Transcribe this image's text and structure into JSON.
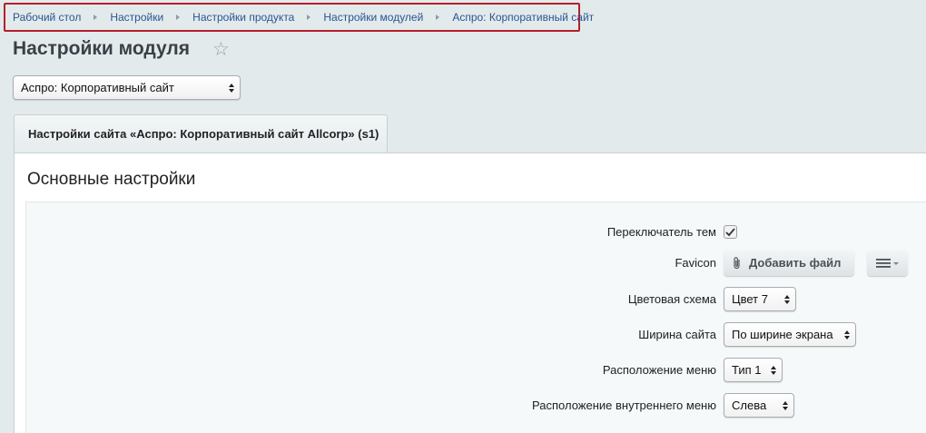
{
  "breadcrumb": {
    "items": [
      "Рабочий стол",
      "Настройки",
      "Настройки продукта",
      "Настройки модулей",
      "Аспро: Корпоративный сайт"
    ]
  },
  "header": {
    "title": "Настройки модуля"
  },
  "module_select": {
    "value": "Аспро: Корпоративный сайт"
  },
  "tabs": [
    {
      "label": "Настройки сайта «Аспро: Корпоративный сайт Allcorp» (s1)"
    }
  ],
  "section": {
    "title": "Основные настройки"
  },
  "fields": {
    "theme_switcher": {
      "label": "Переключатель тем",
      "checked": true
    },
    "favicon": {
      "label": "Favicon",
      "button_label": "Добавить файл"
    },
    "color_scheme": {
      "label": "Цветовая схема",
      "value": "Цвет 7"
    },
    "site_width": {
      "label": "Ширина сайта",
      "value": "По ширине экрана"
    },
    "menu_position": {
      "label": "Расположение меню",
      "value": "Тип 1"
    },
    "inner_menu_position": {
      "label": "Расположение внутреннего меню",
      "value": "Слева"
    }
  },
  "colors": {
    "breadcrumb_highlight": "#b41f2a",
    "link": "#2a5590",
    "background": "#e3eaec"
  }
}
